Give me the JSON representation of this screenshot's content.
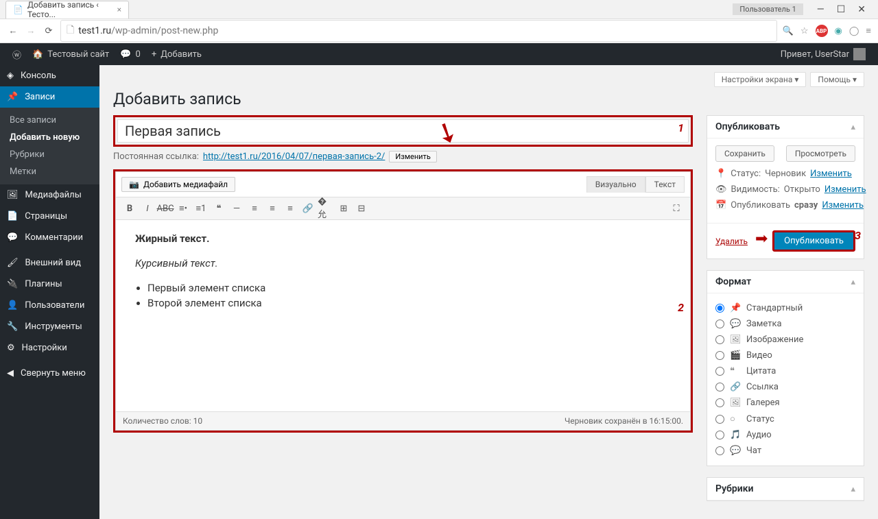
{
  "browser": {
    "tab_title": "Добавить запись ‹ Тесто...",
    "user_badge": "Пользователь 1",
    "url_domain": "test1.ru",
    "url_path": "/wp-admin/post-new.php"
  },
  "adminbar": {
    "site": "Тестовый сайт",
    "comments": "0",
    "add": "Добавить",
    "greeting": "Привет, UserStar"
  },
  "sidebar": {
    "items": [
      {
        "label": "Консоль",
        "icon": "dashboard"
      },
      {
        "label": "Записи",
        "icon": "pin",
        "current": true
      },
      {
        "label": "Медиафайлы",
        "icon": "media"
      },
      {
        "label": "Страницы",
        "icon": "page"
      },
      {
        "label": "Комментарии",
        "icon": "comment"
      },
      {
        "label": "Внешний вид",
        "icon": "appearance"
      },
      {
        "label": "Плагины",
        "icon": "plugin"
      },
      {
        "label": "Пользователи",
        "icon": "user"
      },
      {
        "label": "Инструменты",
        "icon": "tool"
      },
      {
        "label": "Настройки",
        "icon": "settings"
      },
      {
        "label": "Свернуть меню",
        "icon": "collapse"
      }
    ],
    "submenu": [
      {
        "label": "Все записи"
      },
      {
        "label": "Добавить новую",
        "current": true
      },
      {
        "label": "Рубрики"
      },
      {
        "label": "Метки"
      }
    ]
  },
  "page": {
    "title": "Добавить запись",
    "screen_options": "Настройки экрана",
    "help": "Помощь"
  },
  "post": {
    "title_value": "Первая запись",
    "permalink_label": "Постоянная ссылка:",
    "permalink_url": "http://test1.ru/2016/04/07/первая-запись-2/",
    "permalink_edit": "Изменить",
    "add_media": "Добавить медиафайл",
    "tab_visual": "Визуально",
    "tab_text": "Текст",
    "content_bold": "Жирный текст.",
    "content_italic": "Курсивный текст.",
    "content_li1": "Первый элемент списка",
    "content_li2": "Второй элемент списка",
    "word_count": "Количество слов: 10",
    "draft_saved": "Черновик сохранён в 16:15:00."
  },
  "publish": {
    "box_title": "Опубликовать",
    "save_draft": "Сохранить",
    "preview": "Просмотреть",
    "status_label": "Статус:",
    "status_value": "Черновик",
    "visibility_label": "Видимость:",
    "visibility_value": "Открыто",
    "schedule_label": "Опубликовать",
    "schedule_value": "сразу",
    "edit": "Изменить",
    "delete": "Удалить",
    "publish_btn": "Опубликовать"
  },
  "format": {
    "box_title": "Формат",
    "options": [
      "Стандартный",
      "Заметка",
      "Изображение",
      "Видео",
      "Цитата",
      "Ссылка",
      "Галерея",
      "Статус",
      "Аудио",
      "Чат"
    ]
  },
  "categories": {
    "box_title": "Рубрики"
  },
  "annotations": {
    "n1": "1",
    "n2": "2",
    "n3": "3"
  }
}
